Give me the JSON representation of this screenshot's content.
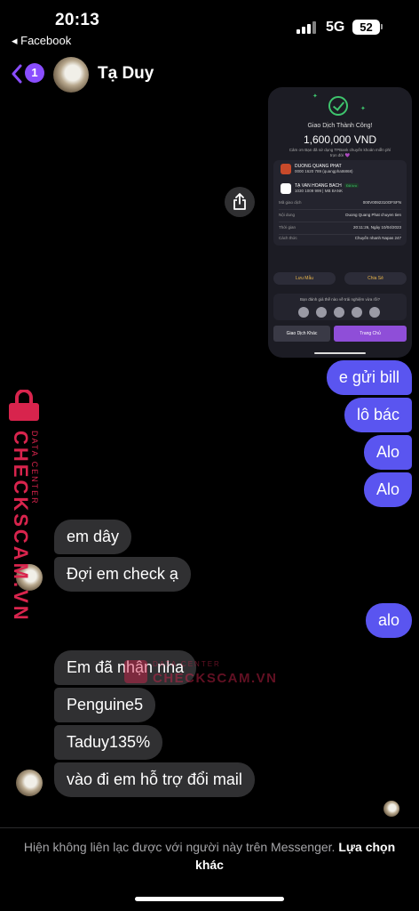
{
  "status_bar": {
    "time": "20:13",
    "back_app": "◂ Facebook",
    "network": "5G",
    "battery": "52"
  },
  "header": {
    "unread_count": "1",
    "contact_name": "Tạ Duy"
  },
  "shared_image": {
    "title": "Giao Dịch Thành Công!",
    "amount": "1,600,000 VND",
    "note": "Cảm ơn Bạn đã sử dụng TPBank chuyển khoản miễn phí trọn đời 💜",
    "sender_name": "DUONG QUANG PHAT",
    "sender_account": "0000 1620 789 (quangphat6868)",
    "receiver_name": "TẠ VAN HOANG BACH",
    "receiver_account": "1030 1009 999 | MB BANK",
    "receiver_tag": "Đã lưu",
    "rows": [
      {
        "label": "Mã giao dịch",
        "value": "000V0092310OFSFN"
      },
      {
        "label": "Nội dung",
        "value": "Duong Quang Phat chuyen tien"
      },
      {
        "label": "Thời gian",
        "value": "20:11:26, Ngày 10/04/2023"
      },
      {
        "label": "Cách thức",
        "value": "Chuyển nhanh Napas 247"
      }
    ],
    "save_template": "Lưu Mẫu",
    "share": "Chia Sẻ",
    "rating_prompt": "Bạn đánh giá thế nào về trải nghiệm vừa rồi?",
    "other_transaction": "Giao Dịch Khác",
    "home": "Trang Chủ"
  },
  "messages": [
    {
      "dir": "out",
      "text": "e gửi bill"
    },
    {
      "dir": "out",
      "text": "lô bác"
    },
    {
      "dir": "out",
      "text": "Alo"
    },
    {
      "dir": "out",
      "text": "Alo"
    },
    {
      "dir": "in",
      "text": "em dây"
    },
    {
      "dir": "in",
      "text": "Đợi em check ạ"
    },
    {
      "dir": "out",
      "text": "alo"
    },
    {
      "dir": "in",
      "text": "Em đã nhận nha"
    },
    {
      "dir": "in",
      "text": "Penguine5"
    },
    {
      "dir": "in",
      "text": "Taduy135%"
    },
    {
      "dir": "in",
      "text": "vào đi em hỗ trợ đổi mail"
    }
  ],
  "watermark": {
    "brand": "CHECKSCAM.VN",
    "sub": "DATA CENTER"
  },
  "footer": {
    "text": "Hiện không liên lạc được với người này trên Messenger.",
    "link": "Lựa chọn khác"
  },
  "colors": {
    "outgoing": "#5a55f0",
    "incoming": "#303032",
    "accent": "#8a4dff",
    "watermark": "#d8244d"
  }
}
